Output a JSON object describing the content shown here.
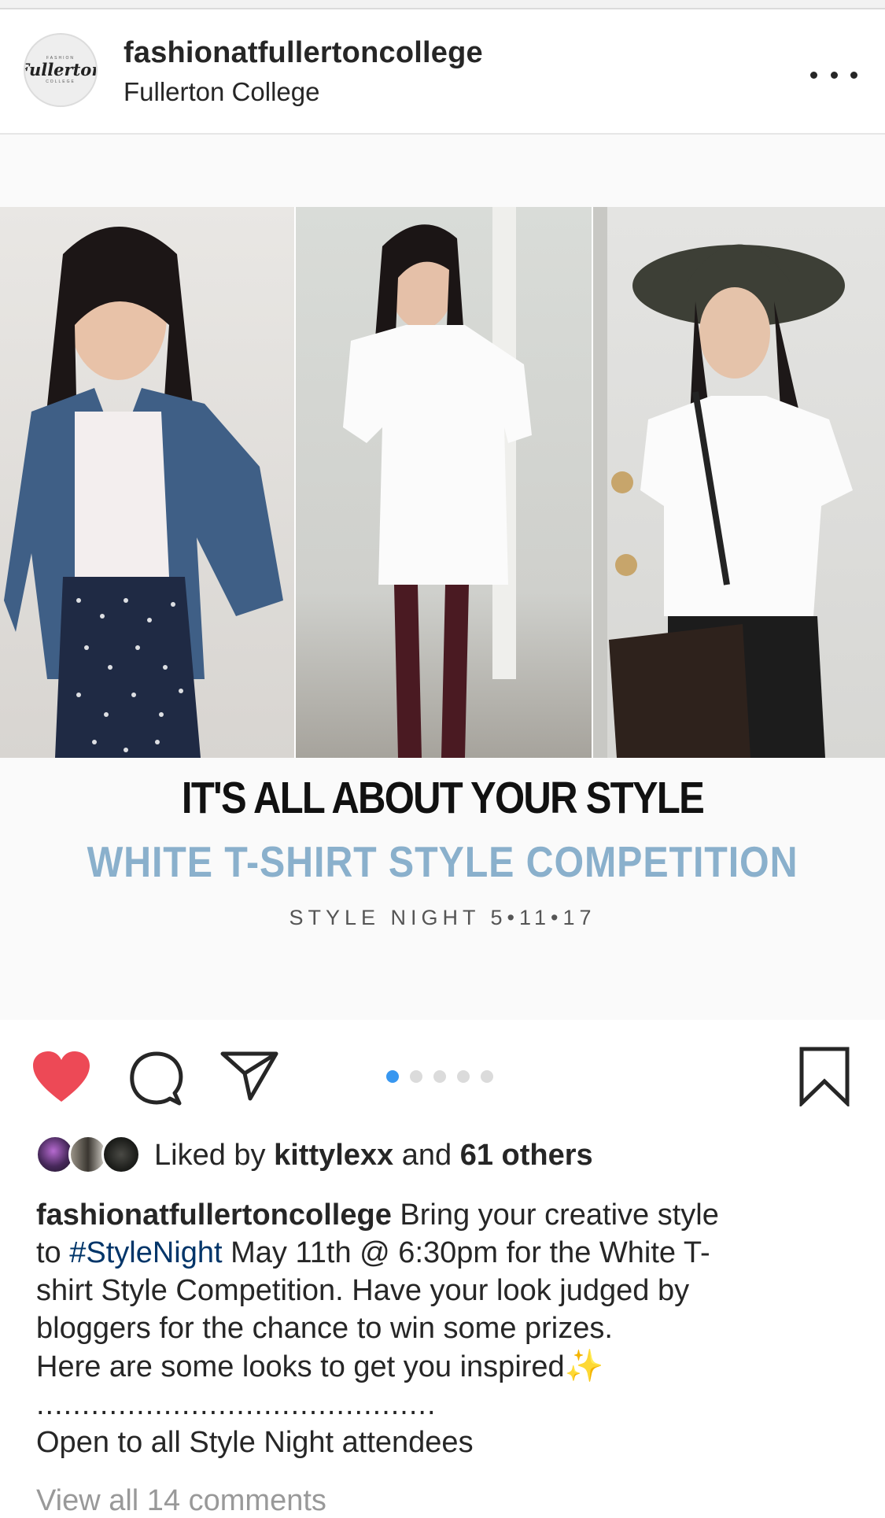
{
  "header": {
    "avatar_logo": "Fullerton",
    "avatar_tiny_top": "FASHION",
    "avatar_tiny_bottom": "COLLEGE",
    "username": "fashionatfullertoncollege",
    "location": "Fullerton College",
    "more_icon": "more-horizontal-icon"
  },
  "media": {
    "graphic_title": "IT'S ALL ABOUT YOUR STYLE",
    "graphic_subtitle": "WHITE T-SHIRT STYLE COMPETITION",
    "graphic_date": "STYLE NIGHT 5•11•17",
    "carousel": {
      "total": 5,
      "active_index": 0,
      "active_color": "#3897f0"
    }
  },
  "actions": {
    "like_icon": "heart-filled-icon",
    "like_color": "#ed4956",
    "comment_icon": "comment-icon",
    "share_icon": "direct-share-icon",
    "save_icon": "bookmark-icon"
  },
  "likes": {
    "prefix": "Liked by ",
    "user": "kittylexx",
    "middle": " and ",
    "others": "61 others"
  },
  "caption": {
    "user": "fashionatfullertoncollege",
    "line1_rest": " Bring your creative style",
    "line2_pre": "to ",
    "hashtag": "#StyleNight",
    "line2_post": " May 11th @ 6:30pm for the White T-",
    "line3": "shirt Style Competition. Have your look judged by",
    "line4": "bloggers for the chance to win some prizes.",
    "line5": "Here are some looks to get you inspired",
    "sparkles": "✨",
    "line6": "............................................",
    "line7": "Open to all Style Night attendees",
    "hashtag_color": "#003569"
  },
  "comments": {
    "view_all": "View all 14 comments"
  }
}
